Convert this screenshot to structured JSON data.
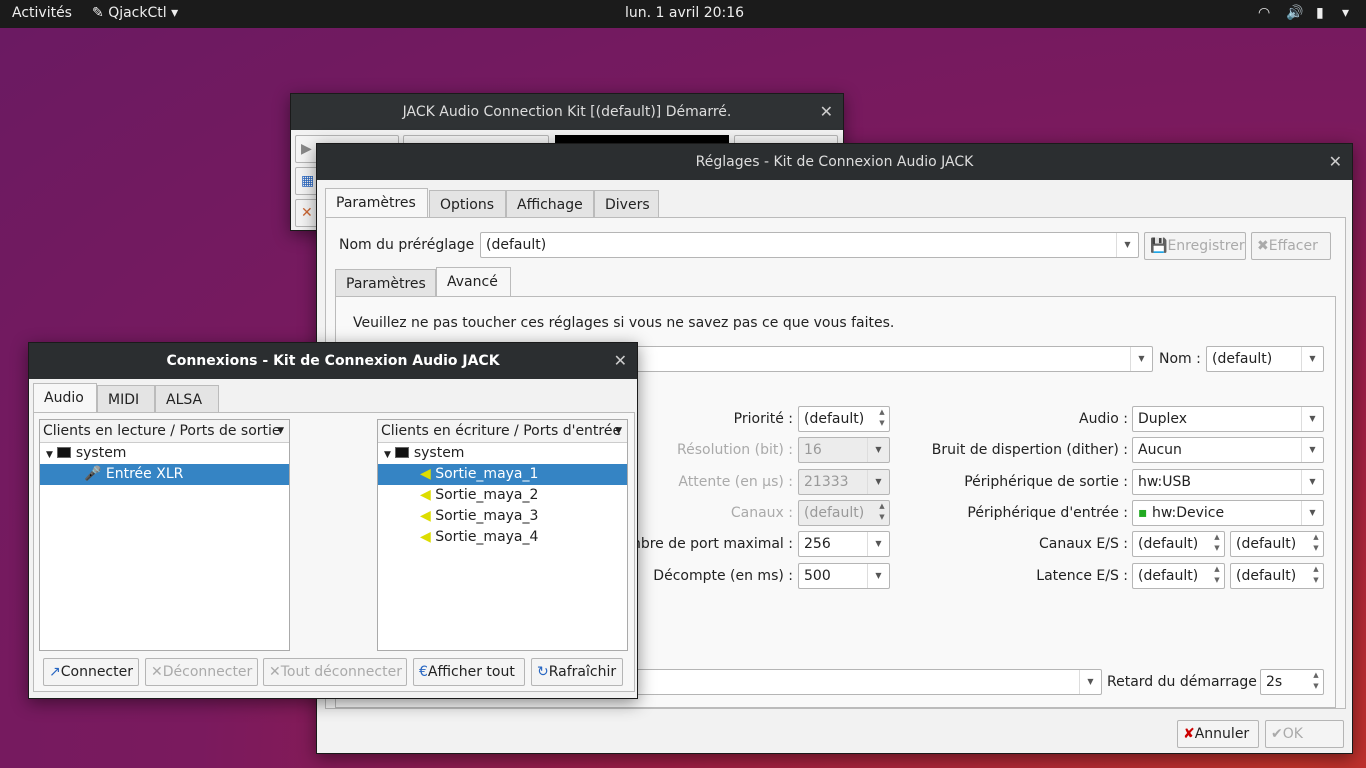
{
  "topbar": {
    "activities": "Activités",
    "app": "QjackCtl",
    "clock": "lun. 1 avril  20:16"
  },
  "main_window": {
    "title": "JACK Audio Connection Kit [(default)] Démarré."
  },
  "settings": {
    "title": "Réglages - Kit de Connexion Audio JACK",
    "tabs": [
      "Paramètres",
      "Options",
      "Affichage",
      "Divers"
    ],
    "preset_label": "Nom du préréglage :",
    "preset_value": "(default)",
    "save": "Enregistrer",
    "delete": "Effacer",
    "subtabs": [
      "Paramètres",
      "Avancé"
    ],
    "warning": "Veuillez ne pas toucher ces réglages si vous ne savez pas ce que vous faites.",
    "name_label": "Nom :",
    "name_value": "(default)",
    "left": [
      {
        "label": "Priorité :",
        "value": "(default)",
        "disabled": false
      },
      {
        "label": "Résolution (bit) :",
        "value": "16",
        "disabled": true
      },
      {
        "label": "Attente (en µs) :",
        "value": "21333",
        "disabled": true
      },
      {
        "label": "Canaux :",
        "value": "(default)",
        "disabled": true
      },
      {
        "label": "mbre de port maximal :",
        "value": "256",
        "disabled": false
      },
      {
        "label": "Décompte (en ms) :",
        "value": "500",
        "disabled": false
      }
    ],
    "right": [
      {
        "label": "Audio :",
        "value": "Duplex"
      },
      {
        "label": "Bruit de dispertion (dither) :",
        "value": "Aucun"
      },
      {
        "label": "Périphérique de sortie :",
        "value": "hw:USB"
      },
      {
        "label": "Périphérique d'entrée :",
        "value": "hw:Device"
      },
      {
        "label": "Canaux E/S :",
        "value": "(default)",
        "value2": "(default)"
      },
      {
        "label": "Latence E/S :",
        "value": "(default)",
        "value2": "(default)"
      }
    ],
    "delay_label": "Retard du démarrage :",
    "delay_value": "2s",
    "cancel": "Annuler",
    "ok": "OK"
  },
  "connections": {
    "title": "Connexions - Kit de Connexion Audio JACK",
    "tabs": [
      "Audio",
      "MIDI",
      "ALSA"
    ],
    "left_header": "Clients en lecture / Ports de sortie",
    "right_header": "Clients en écriture / Ports d'entrée",
    "left_client": "system",
    "left_ports": [
      "Entrée XLR"
    ],
    "right_client": "system",
    "right_ports": [
      "Sortie_maya_1",
      "Sortie_maya_2",
      "Sortie_maya_3",
      "Sortie_maya_4"
    ],
    "buttons": [
      "Connecter",
      "Déconnecter",
      "Tout déconnecter",
      "Afficher tout",
      "Rafraîchir"
    ]
  },
  "colors": {
    "selection": "#3584c4",
    "titlebar": "#2f3234"
  }
}
